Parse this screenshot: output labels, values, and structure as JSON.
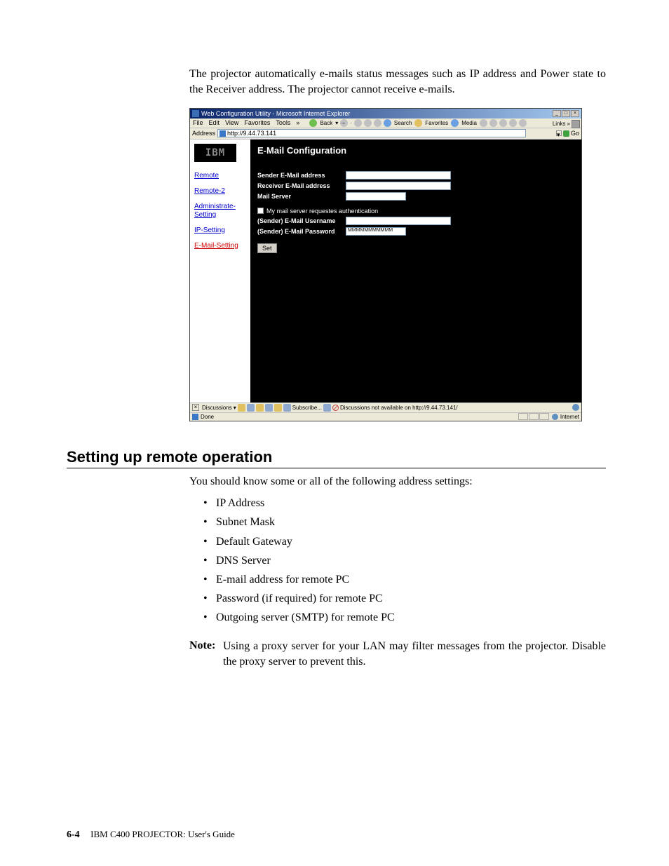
{
  "intro": "The projector automatically e-mails status messages such as IP address and Power state to the Receiver address. The projector cannot receive e-mails.",
  "screenshot": {
    "window_title": "Web Configuration Utility - Microsoft Internet Explorer",
    "menubar": [
      "File",
      "Edit",
      "View",
      "Favorites",
      "Tools"
    ],
    "toolbar": {
      "back": "Back",
      "search": "Search",
      "favorites": "Favorites",
      "media": "Media"
    },
    "links_label": "Links",
    "address_label": "Address",
    "address_value": "http://9.44.73.141",
    "go_label": "Go",
    "logo": "IBM",
    "nav": {
      "remote": "Remote",
      "remote2": "Remote-2",
      "admin": "Administrate-Setting",
      "ip": "IP-Setting",
      "email": "E-Mail-Setting"
    },
    "panel": {
      "title": "E-Mail Configuration",
      "sender_addr": "Sender E-Mail address",
      "receiver_addr": "Receiver E-Mail address",
      "mail_server": "Mail Server",
      "auth_check": "My mail server requestes authentication",
      "sender_user": "(Sender) E-Mail Username",
      "sender_pass": "(Sender) E-Mail Password",
      "password_value": "MMMMMMMMMMM",
      "set_btn": "Set"
    },
    "discussions": {
      "label": "Discussions",
      "subscribe": "Subscribe...",
      "not_available": "Discussions not available on http://9.44.73.141/"
    },
    "status": {
      "done": "Done",
      "zone": "Internet"
    }
  },
  "section_heading": "Setting up remote operation",
  "body_text": "You should know some or all of the following address settings:",
  "bullets": {
    "b1": "IP Address",
    "b2": "Subnet Mask",
    "b3": "Default Gateway",
    "b4": "DNS Server",
    "b5": "E-mail address for remote PC",
    "b6": "Password (if required) for remote PC",
    "b7": "Outgoing server (SMTP) for remote PC"
  },
  "note": {
    "label": "Note:",
    "text": "Using a proxy server for your LAN may filter messages from the projector. Disable the proxy server to prevent this."
  },
  "footer": {
    "page": "6-4",
    "title": "IBM C400 PROJECTOR: User's Guide"
  }
}
